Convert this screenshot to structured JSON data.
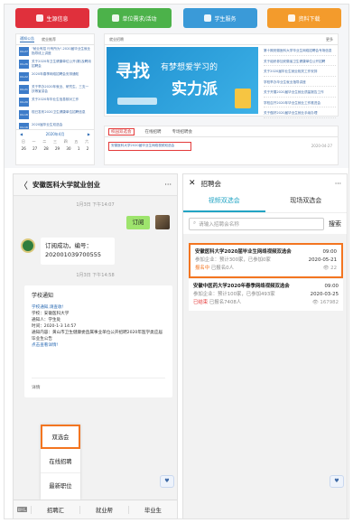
{
  "top": {
    "buttons": [
      "生源信息",
      "单位需求/活动",
      "学生服务",
      "资料下载"
    ],
    "news_tabs": [
      "通知公告",
      "就业推荐"
    ],
    "news_items": [
      {
        "date": "04-27",
        "text": "\"就业有招 行有所为\"-2020届毕业生就业指导线上讲座"
      },
      {
        "date": "04-26",
        "text": "关于2020年卫生健康单位公开(赛)及聘用招聘会"
      },
      {
        "date": "04-22",
        "text": "2020年春季网络招聘会安排通知"
      },
      {
        "date": "04-21",
        "text": "关于举办2020年就业、研究生、三支一扶等宣讲会"
      },
      {
        "date": "04-20",
        "text": "关于2020年毕业生信息核对工作"
      },
      {
        "date": "04-18",
        "text": "现已发布2020卫生健康单位招聘信息"
      },
      {
        "date": "04-16",
        "text": "2020届毕业生双选会"
      }
    ],
    "recruit_tab": "就业招聘",
    "more": "更多",
    "banner": {
      "t1": "寻找",
      "t2": "有梦想爱学习的",
      "t3": "实力派"
    },
    "right_list": [
      "第十期安徽医科大学毕业生网络招聘会专场信息",
      "关于组织参加安徽省卫生健康单位公开招聘",
      "关于2020届毕业生就业相关工作安排",
      "学校举办毕业生就业指导讲座",
      "关于开展2020届毕业生就业质量报告工作",
      "学校召开2020年毕业生就业工作推进会",
      "关于做好2020届毕业生就业手续办理"
    ],
    "calendar": {
      "prev": "◀",
      "title": "2020年4月",
      "next": "▶",
      "week": [
        "日",
        "一",
        "二",
        "三",
        "四",
        "五",
        "六"
      ],
      "days": [
        "26",
        "27",
        "28",
        "29",
        "30",
        "1",
        "2"
      ]
    },
    "fair_tabs": [
      "校园双选会",
      "在线招聘",
      "专场招聘会"
    ],
    "fair_link": "安徽医科大学2020届毕业生网络视频双选会",
    "fair_date": "2020-04-27"
  },
  "left": {
    "title": "安徽医科大学就业创业",
    "back": "〈",
    "more": "···",
    "time1": "1月3日 下午14:07",
    "msg_out": "订阅",
    "msg_in": "订阅成功，编号：202001039700555",
    "time2": "1月3日 下午14:58",
    "card": {
      "title": "学校通知",
      "l1": "学校通知,请查收!",
      "l2": "学校：安徽医科大学",
      "l3": "通知人：学生处",
      "l4": "时间：2020-1-3 14:57",
      "l5": "通知内容：黄山市卫生健康委直属事业单位公开招聘2020年医学类应届毕业生公告",
      "l6": "点击查看详情!",
      "detail": "详情"
    },
    "popup": [
      "双选会",
      "在线招聘",
      "最新职位"
    ],
    "footer": [
      "招聘汇",
      "就业帮",
      "毕业生"
    ]
  },
  "right": {
    "close": "✕",
    "title": "招聘会",
    "more": "···",
    "tabs": [
      "视频双选会",
      "现场双选会"
    ],
    "search_placeholder": "请输入招聘会名称",
    "search_btn": "搜索",
    "fairs": [
      {
        "title": "安徽医科大学2020届毕业生网络视频双选会",
        "time": "09:00",
        "sub": "参加企业：预计300家，已参加0家",
        "date": "2020-05-21",
        "status": "报名中",
        "joined": "已报名0人",
        "views": "22"
      },
      {
        "title": "安徽中医药大学2020年春季网络视频双选会",
        "time": "09:00",
        "sub": "参加企业：预计100家，已参加493家",
        "date": "2020-03-25",
        "status": "已结束",
        "joined": "已报名7408人",
        "views": "167982"
      }
    ]
  },
  "colors": {
    "red": "#e0303c",
    "green": "#4cb24a",
    "blue": "#3a9ad8",
    "orange": "#f39b2c",
    "highlight": "#f37520",
    "teal": "#22a4c4"
  }
}
